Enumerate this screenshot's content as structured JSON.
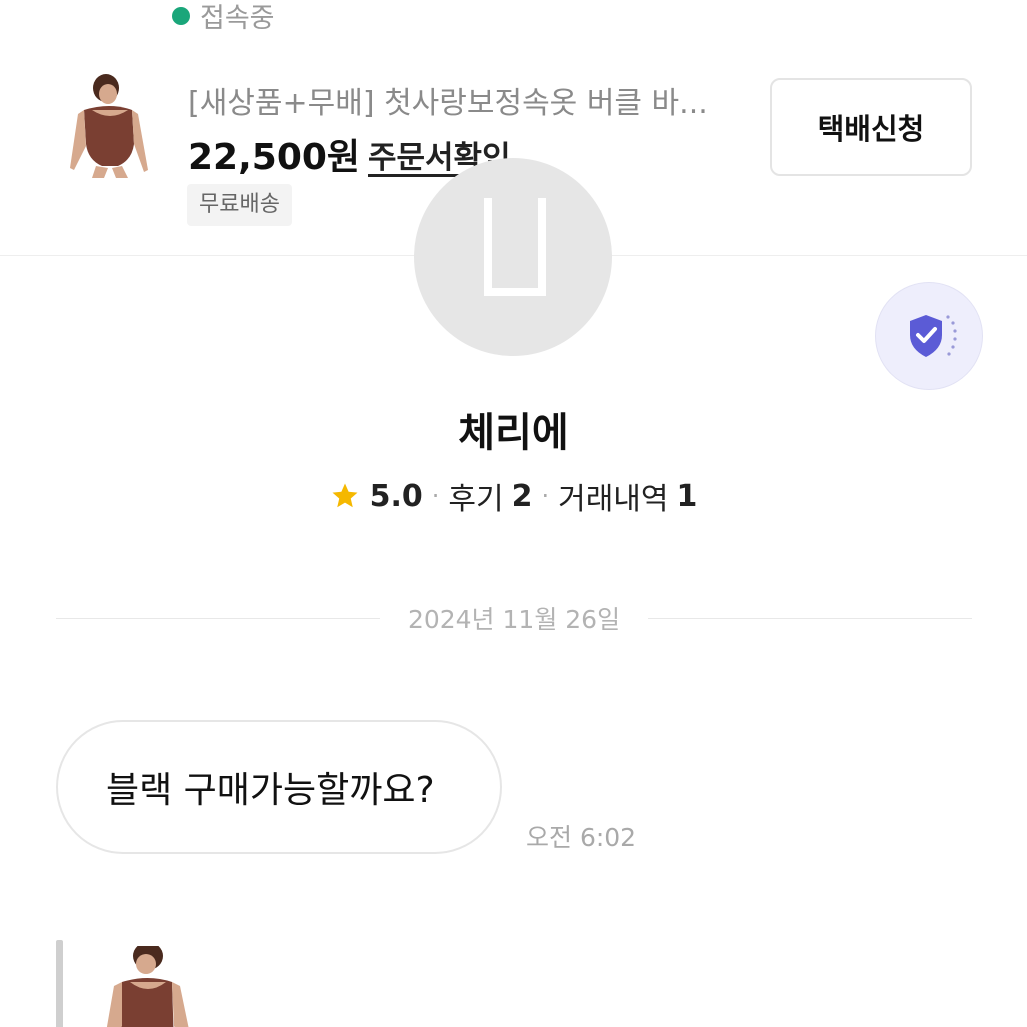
{
  "header": {
    "status_text": "접속중"
  },
  "product": {
    "title": "[새상품+무배] 첫사랑보정속옷 버클 바...",
    "price": "22,500원",
    "order_link": "주문서확인",
    "shipping_badge": "무료배송",
    "delivery_button": "택배신청"
  },
  "seller": {
    "name": "체리에",
    "rating": "5.0",
    "reviews_label": "후기",
    "reviews_count": "2",
    "trades_label": "거래내역",
    "trades_count": "1"
  },
  "chat": {
    "date": "2024년 11월 26일",
    "messages": [
      {
        "text": "블랙 구매가능할까요?",
        "time": "오전 6:02"
      }
    ]
  },
  "colors": {
    "online": "#1aa67a",
    "star": "#f5b800",
    "shield": "#5b5bd6"
  }
}
